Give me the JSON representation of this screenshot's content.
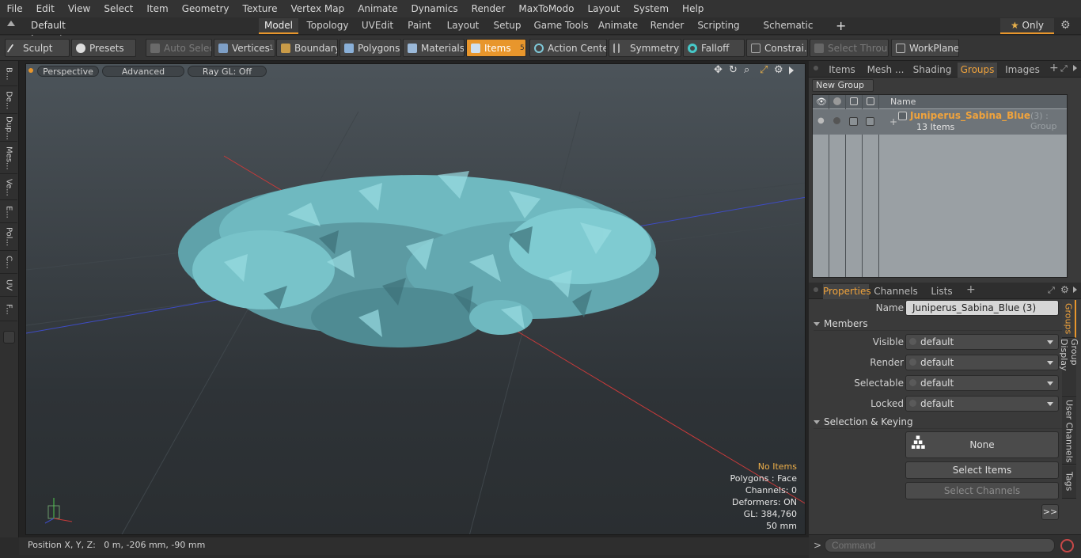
{
  "menu": [
    "File",
    "Edit",
    "View",
    "Select",
    "Item",
    "Geometry",
    "Texture",
    "Vertex Map",
    "Animate",
    "Dynamics",
    "Render",
    "MaxToModo",
    "Layout",
    "System",
    "Help"
  ],
  "layouts": {
    "selector": "Default Layouts",
    "tabs": [
      "Model",
      "Topology",
      "UVEdit",
      "Paint",
      "Layout",
      "Setup",
      "Game Tools",
      "Animate",
      "Render",
      "Scripting",
      "Schematic Fusion"
    ],
    "active": "Model",
    "only_label": "Only"
  },
  "toolbar": {
    "sculpt": "Sculpt",
    "presets": "Presets",
    "auto_select": "Auto Select",
    "vertices": "Vertices",
    "vertices_count": "1",
    "boundary": "Boundary",
    "polygons": "Polygons",
    "materials": "Materials",
    "items": "Items",
    "items_count": "5",
    "action_center": "Action Center",
    "symmetry": "Symmetry",
    "falloff": "Falloff",
    "constraints": "Constrai...",
    "select_through": "Select Through",
    "workplane": "WorkPlane"
  },
  "left_tabs": [
    "B...",
    "De...",
    "Dup...",
    "Mes...",
    "Ve...",
    "E...",
    "Pol...",
    "C...",
    "UV",
    "F..."
  ],
  "viewport": {
    "perspective": "Perspective",
    "advanced": "Advanced",
    "raygl": "Ray GL: Off",
    "info": {
      "items": "No Items",
      "polygons": "Polygons : Face",
      "channels": "Channels: 0",
      "deformers": "Deformers: ON",
      "gl": "GL: 384,760",
      "scale": "50 mm"
    }
  },
  "status": "Position X, Y, Z:   0 m, -206 mm, -90 mm",
  "groups_panel": {
    "tabs": [
      "Items",
      "Mesh ...",
      "Shading",
      "Groups",
      "Images"
    ],
    "active_tab": "Groups",
    "new_group": "New Group",
    "name_header": "Name",
    "row": {
      "name": "Juniperus_Sabina_Blue",
      "suffix": "(3) : Group",
      "items": "13 Items"
    }
  },
  "properties_panel": {
    "tabs": [
      "Properties",
      "Channels",
      "Lists"
    ],
    "active_tab": "Properties",
    "name_label": "Name",
    "name_value": "Juniperus_Sabina_Blue (3)",
    "members_label": "Members",
    "fields": [
      {
        "label": "Visible",
        "value": "default"
      },
      {
        "label": "Render",
        "value": "default"
      },
      {
        "label": "Selectable",
        "value": "default"
      },
      {
        "label": "Locked",
        "value": "default"
      }
    ],
    "selection_label": "Selection & Keying",
    "none_btn": "None",
    "select_items": "Select Items",
    "select_channels": "Select Channels",
    "more": ">>",
    "side_tabs": [
      "Groups",
      "Group Display",
      "User Channels",
      "Tags"
    ],
    "command_placeholder": "Command"
  },
  "colors": {
    "accent": "#e8962c",
    "group_name": "#f0a33c",
    "foliage": "#6fb9c0"
  }
}
